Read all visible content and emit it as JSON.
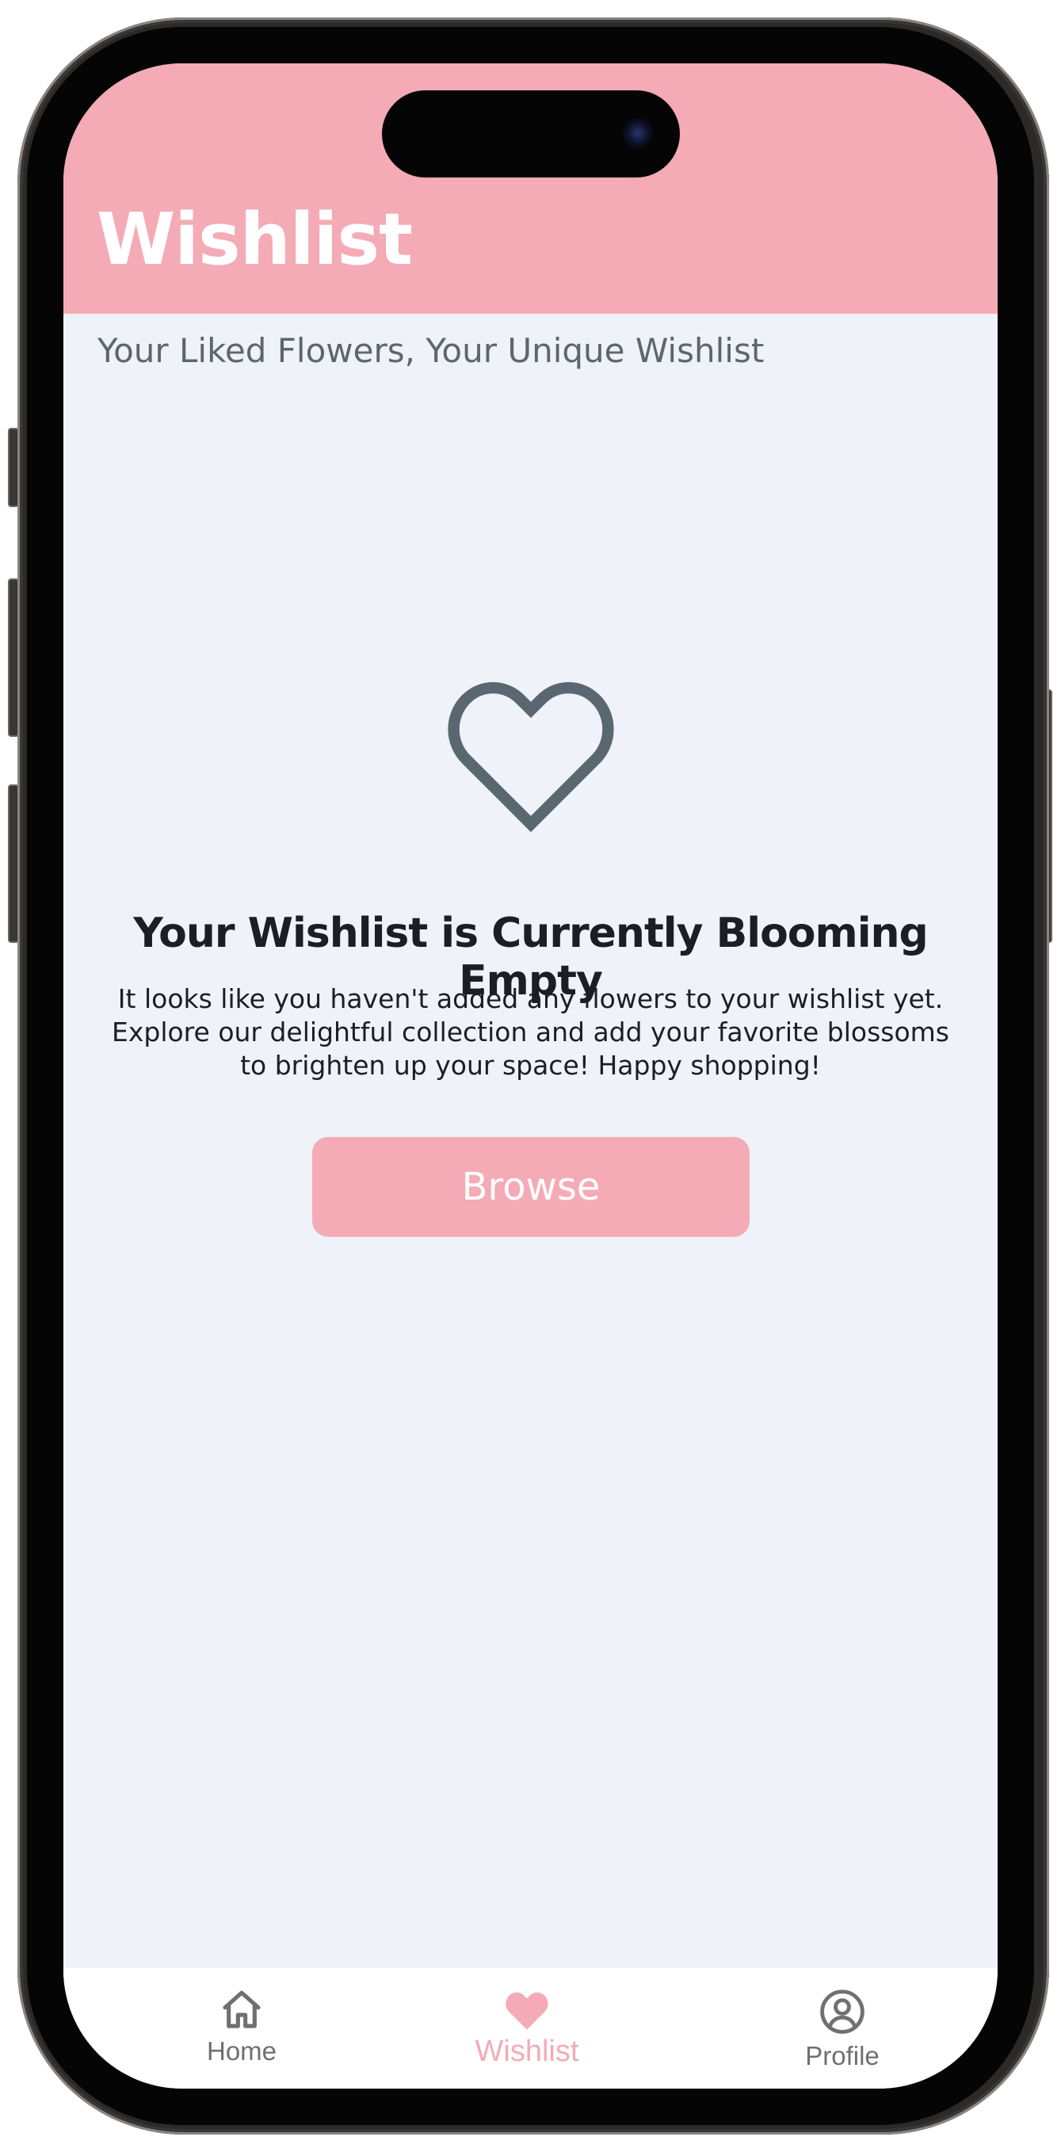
{
  "header": {
    "title": "Wishlist",
    "subtitle": "Your Liked Flowers, Your Unique Wishlist",
    "background_color": "#f4abb5"
  },
  "empty_state": {
    "icon": "heart-outline-icon",
    "title": "Your Wishlist is Currently Blooming Empty",
    "message": "It looks like you haven't added any flowers to your wishlist yet. Explore our delightful collection and add your favorite blossoms to brighten up your space! Happy shopping!",
    "browse_label": "Browse"
  },
  "tabbar": {
    "items": [
      {
        "label": "Home",
        "icon": "home-icon",
        "active": false
      },
      {
        "label": "Wishlist",
        "icon": "heart-icon",
        "active": true
      },
      {
        "label": "Profile",
        "icon": "user-circle-icon",
        "active": false
      }
    ],
    "active_color": "#f4abb5",
    "inactive_color": "#707070"
  }
}
